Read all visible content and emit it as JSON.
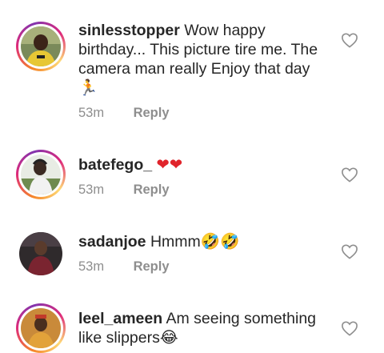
{
  "comments": [
    {
      "username": "sinlesstopper",
      "text": "Wow happy birthday... This picture tire me. The camera man really Enjoy that day",
      "emoji": "🏃",
      "time": "53m",
      "reply_label": "Reply",
      "has_story_ring": true
    },
    {
      "username": "batefego_",
      "text": "",
      "emoji": "❤❤",
      "time": "53m",
      "reply_label": "Reply",
      "has_story_ring": true
    },
    {
      "username": "sadanjoe",
      "text": "Hmmm",
      "emoji": "🤣🤣",
      "time": "53m",
      "reply_label": "Reply",
      "has_story_ring": false
    },
    {
      "username": "leel_ameen",
      "text": "Am seeing something like slippers",
      "emoji": "😂",
      "time": "",
      "reply_label": "",
      "has_story_ring": true
    }
  ],
  "colors": {
    "text": "#262626",
    "meta": "#8e8e8e",
    "heart_emoji": "#e0242b"
  },
  "icons": {
    "like": "heart-outline-icon"
  }
}
